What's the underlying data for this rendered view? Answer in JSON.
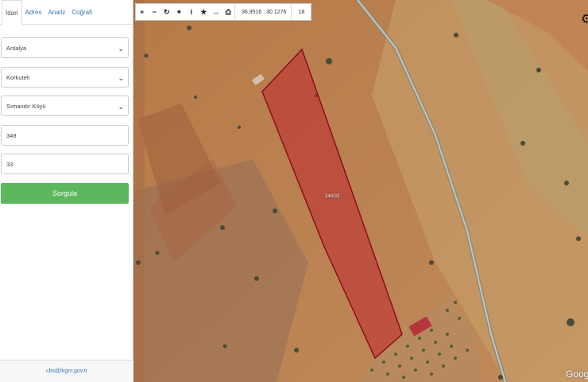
{
  "tabs": [
    "İdari",
    "Adres",
    "Analiz",
    "Coğrafi"
  ],
  "form": {
    "province": "Antalya",
    "district": "Korkuteli",
    "neighborhood": "Sımandır Köyü",
    "block": "348",
    "parcel": "33",
    "query_button": "Sorgula"
  },
  "footer_email": "cbs@tkgm.gov.tr",
  "toolbar": {
    "icons": [
      "zoom-in-icon",
      "zoom-out-icon",
      "refresh-icon",
      "locate-icon",
      "info-icon",
      "favorite-star-icon",
      "measure-icon",
      "print-icon"
    ],
    "coordinates": "36.9516 : 30.1276",
    "zoom_level": "18"
  },
  "map": {
    "parcel_label": "348/33",
    "attribution": "Google",
    "parcel_color": "#c0262f"
  }
}
